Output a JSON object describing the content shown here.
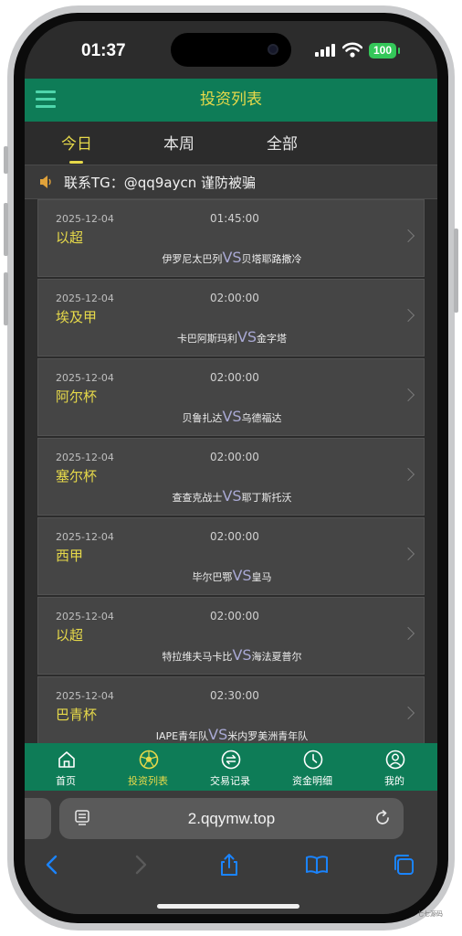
{
  "status_bar": {
    "time": "01:37",
    "battery": "100"
  },
  "header": {
    "title": "投资列表"
  },
  "tabs": [
    {
      "label": "今日",
      "active": true
    },
    {
      "label": "本周",
      "active": false
    },
    {
      "label": "全部",
      "active": false
    }
  ],
  "notice": {
    "text": "联系TG：@qq9aycn 谨防被骗"
  },
  "matches": [
    {
      "date": "2025-12-04",
      "time": "01:45:00",
      "league": "以超",
      "home": "伊罗尼太巴列",
      "vs": "VS",
      "away": "贝塔耶路撒冷"
    },
    {
      "date": "2025-12-04",
      "time": "02:00:00",
      "league": "埃及甲",
      "home": "卡巴阿斯玛利",
      "vs": "VS",
      "away": "金字塔"
    },
    {
      "date": "2025-12-04",
      "time": "02:00:00",
      "league": "阿尔杯",
      "home": "贝鲁扎达",
      "vs": "VS",
      "away": "乌德福达"
    },
    {
      "date": "2025-12-04",
      "time": "02:00:00",
      "league": "塞尔杯",
      "home": "查查克战士",
      "vs": "VS",
      "away": "耶丁斯托沃"
    },
    {
      "date": "2025-12-04",
      "time": "02:00:00",
      "league": "西甲",
      "home": "毕尔巴鄂",
      "vs": "VS",
      "away": "皇马"
    },
    {
      "date": "2025-12-04",
      "time": "02:00:00",
      "league": "以超",
      "home": "特拉维夫马卡比",
      "vs": "VS",
      "away": "海法夏普尔"
    },
    {
      "date": "2025-12-04",
      "time": "02:30:00",
      "league": "巴青杯",
      "home": "IAPE青年队",
      "vs": "VS",
      "away": "米内罗美洲青年队"
    }
  ],
  "bottom_nav": [
    {
      "label": "首页",
      "icon": "home-icon",
      "active": false
    },
    {
      "label": "投资列表",
      "icon": "soccer-ball-icon",
      "active": true
    },
    {
      "label": "交易记录",
      "icon": "exchange-icon",
      "active": false
    },
    {
      "label": "资金明细",
      "icon": "clock-icon",
      "active": false
    },
    {
      "label": "我的",
      "icon": "user-icon",
      "active": false
    }
  ],
  "browser": {
    "url": "2.qqymw.top"
  },
  "watermark": "七七源码",
  "colors": {
    "header_bg": "#0e7c57",
    "accent_yellow": "#e6d94a",
    "card_bg": "#454545",
    "page_bg": "#2c2c2c",
    "battery_green": "#34c759",
    "browser_blue": "#1a84ff"
  }
}
